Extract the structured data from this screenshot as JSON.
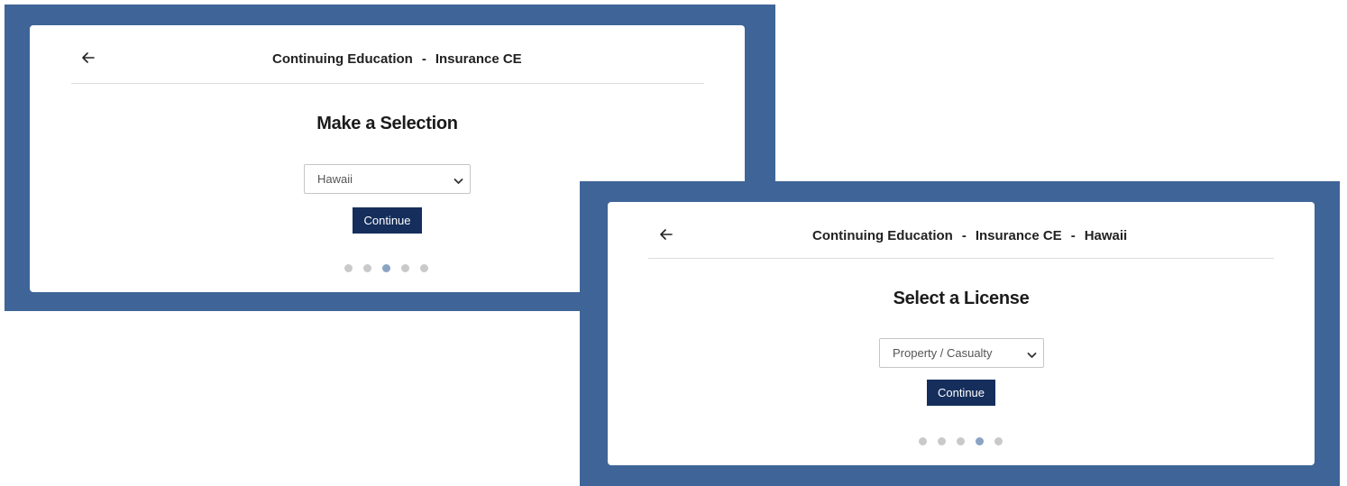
{
  "panel1": {
    "breadcrumb": [
      "Continuing Education",
      "Insurance CE"
    ],
    "separator": "-",
    "heading": "Make a Selection",
    "select_value": "Hawaii",
    "continue_label": "Continue",
    "step_count": 5,
    "active_step": 3
  },
  "panel2": {
    "breadcrumb": [
      "Continuing Education",
      "Insurance CE",
      "Hawaii"
    ],
    "separator": "-",
    "heading": "Select a License",
    "select_value": "Property / Casualty",
    "continue_label": "Continue",
    "step_count": 5,
    "active_step": 4
  },
  "icons": {
    "back": "arrow-left-icon",
    "dropdown": "chevron-down-icon"
  },
  "colors": {
    "frame": "#3f6598",
    "button": "#152e5c",
    "dot_active": "#8aa3c3",
    "dot_inactive": "#c9c9c9"
  }
}
